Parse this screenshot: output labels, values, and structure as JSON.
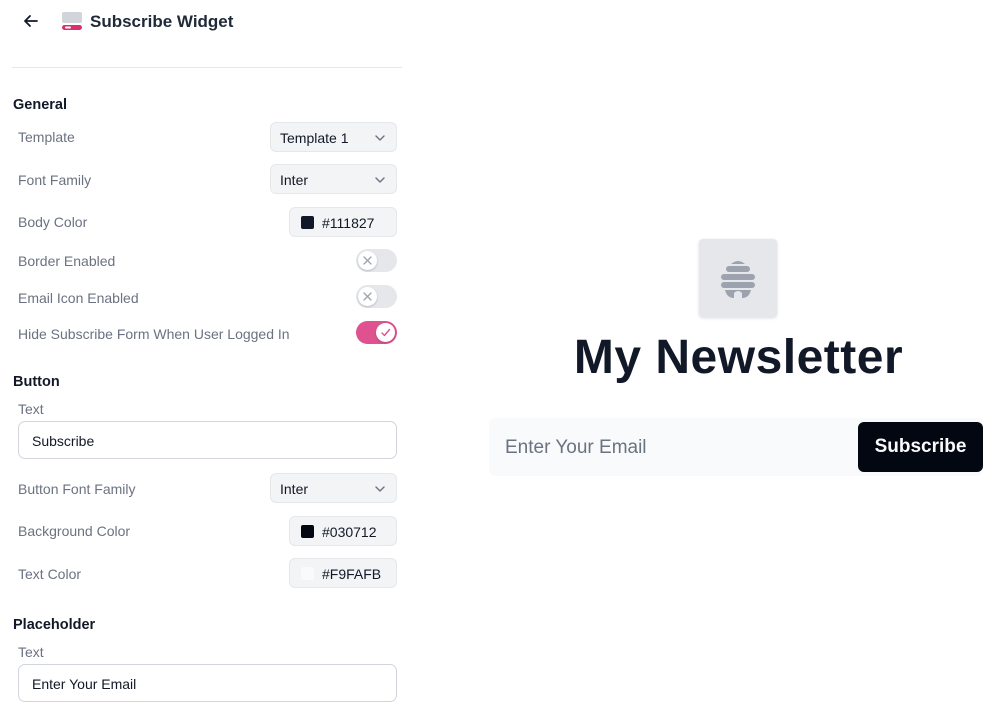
{
  "header": {
    "back_icon": "arrow-left-icon",
    "app_icon": "widget-icon",
    "title": "Subscribe Widget"
  },
  "general": {
    "title": "General",
    "template": {
      "label": "Template",
      "value": "Template 1"
    },
    "font_family": {
      "label": "Font Family",
      "value": "Inter"
    },
    "body_color": {
      "label": "Body Color",
      "value": "#111827"
    },
    "border_enabled": {
      "label": "Border Enabled",
      "on": false
    },
    "email_icon_enabled": {
      "label": "Email Icon Enabled",
      "on": false
    },
    "hide_when_logged_in": {
      "label": "Hide Subscribe Form When User Logged In",
      "on": true
    }
  },
  "button": {
    "title": "Button",
    "text_label": "Text",
    "text_value": "Subscribe",
    "font_family": {
      "label": "Button Font Family",
      "value": "Inter"
    },
    "background_color": {
      "label": "Background Color",
      "value": "#030712"
    },
    "text_color": {
      "label": "Text Color",
      "value": "#F9FAFB"
    }
  },
  "placeholder": {
    "title": "Placeholder",
    "text_label": "Text",
    "text_value": "Enter Your Email"
  },
  "preview": {
    "logo_icon": "beehive-icon",
    "headline": "My Newsletter",
    "email_placeholder": "Enter Your Email",
    "button_label": "Subscribe"
  },
  "colors": {
    "accent": "#e0528f",
    "body": "#111827",
    "button_bg": "#030712",
    "button_text": "#F9FAFB"
  }
}
